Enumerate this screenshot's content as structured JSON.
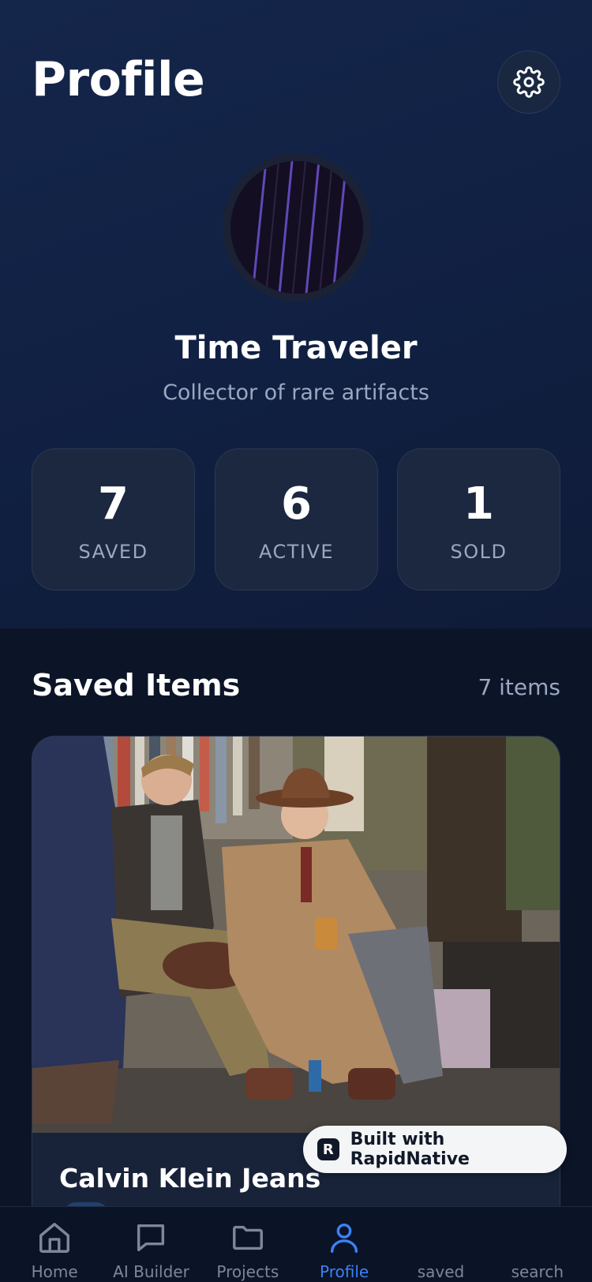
{
  "header": {
    "title": "Profile",
    "settings_icon": "gear-icon"
  },
  "profile": {
    "name": "Time Traveler",
    "bio": "Collector of rare artifacts"
  },
  "stats": [
    {
      "value": "7",
      "label": "SAVED"
    },
    {
      "value": "6",
      "label": "ACTIVE"
    },
    {
      "value": "1",
      "label": "SOLD"
    }
  ],
  "saved_section": {
    "title": "Saved Items",
    "count": "7 items",
    "items": [
      {
        "title": "Calvin Klein Jeans",
        "image": "vintage-market-photo"
      }
    ]
  },
  "badge": {
    "text": "Built with RapidNative",
    "logo_glyph": "R"
  },
  "tabs": [
    {
      "label": "Home",
      "icon": "home-icon",
      "active": false
    },
    {
      "label": "AI Builder",
      "icon": "chat-bubble-icon",
      "active": false
    },
    {
      "label": "Projects",
      "icon": "folder-icon",
      "active": false
    },
    {
      "label": "Profile",
      "icon": "user-icon",
      "active": true
    },
    {
      "label": "saved",
      "icon": "bookmark-icon",
      "active": false
    },
    {
      "label": "search",
      "icon": "search-icon",
      "active": false
    }
  ],
  "colors": {
    "accent": "#3b82f6",
    "background": "#0c1428",
    "card": "#1c2740",
    "muted_text": "#9aa8c0"
  }
}
